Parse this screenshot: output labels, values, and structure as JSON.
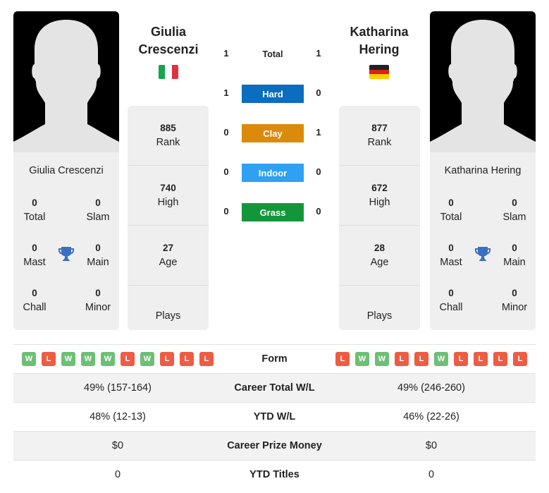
{
  "colors": {
    "hard": "#0b6dbf",
    "clay": "#dc8a0c",
    "indoor": "#2ea1f2",
    "grass": "#13963a",
    "win": "#6dbf75",
    "loss": "#ed5c43",
    "trophy": "#3b6fc2"
  },
  "player_left": {
    "name": "Giulia Crescenzi",
    "name_line1": "Giulia",
    "name_line2": "Crescenzi",
    "flag": "italy-flag",
    "photo": "silhouette-placeholder",
    "titles": {
      "total": {
        "value": "0",
        "label": "Total"
      },
      "slam": {
        "value": "0",
        "label": "Slam"
      },
      "mast": {
        "value": "0",
        "label": "Mast"
      },
      "main": {
        "value": "0",
        "label": "Main"
      },
      "chall": {
        "value": "0",
        "label": "Chall"
      },
      "minor": {
        "value": "0",
        "label": "Minor"
      }
    },
    "stats": {
      "rank": {
        "value": "885",
        "label": "Rank"
      },
      "high": {
        "value": "740",
        "label": "High"
      },
      "age": {
        "value": "27",
        "label": "Age"
      },
      "plays": {
        "value": "",
        "label": "Plays"
      }
    },
    "form": [
      "W",
      "L",
      "W",
      "W",
      "W",
      "L",
      "W",
      "L",
      "L",
      "L"
    ]
  },
  "player_right": {
    "name": "Katharina Hering",
    "name_line1": "Katharina",
    "name_line2": "Hering",
    "flag": "germany-flag",
    "photo": "silhouette-placeholder",
    "titles": {
      "total": {
        "value": "0",
        "label": "Total"
      },
      "slam": {
        "value": "0",
        "label": "Slam"
      },
      "mast": {
        "value": "0",
        "label": "Mast"
      },
      "main": {
        "value": "0",
        "label": "Main"
      },
      "chall": {
        "value": "0",
        "label": "Chall"
      },
      "minor": {
        "value": "0",
        "label": "Minor"
      }
    },
    "stats": {
      "rank": {
        "value": "877",
        "label": "Rank"
      },
      "high": {
        "value": "672",
        "label": "High"
      },
      "age": {
        "value": "28",
        "label": "Age"
      },
      "plays": {
        "value": "",
        "label": "Plays"
      }
    },
    "form": [
      "L",
      "W",
      "W",
      "L",
      "L",
      "W",
      "L",
      "L",
      "L",
      "L"
    ]
  },
  "h2h": [
    {
      "surface": "Total",
      "left": "1",
      "right": "1"
    },
    {
      "surface": "Hard",
      "left": "1",
      "right": "0"
    },
    {
      "surface": "Clay",
      "left": "0",
      "right": "1"
    },
    {
      "surface": "Indoor",
      "left": "0",
      "right": "0"
    },
    {
      "surface": "Grass",
      "left": "0",
      "right": "0"
    }
  ],
  "comparison": {
    "form_label": "Form",
    "rows": [
      {
        "label": "Career Total W/L",
        "left": "49% (157-164)",
        "right": "49% (246-260)"
      },
      {
        "label": "YTD W/L",
        "left": "48% (12-13)",
        "right": "46% (22-26)"
      },
      {
        "label": "Career Prize Money",
        "left": "$0",
        "right": "$0"
      },
      {
        "label": "YTD Titles",
        "left": "0",
        "right": "0"
      }
    ]
  }
}
